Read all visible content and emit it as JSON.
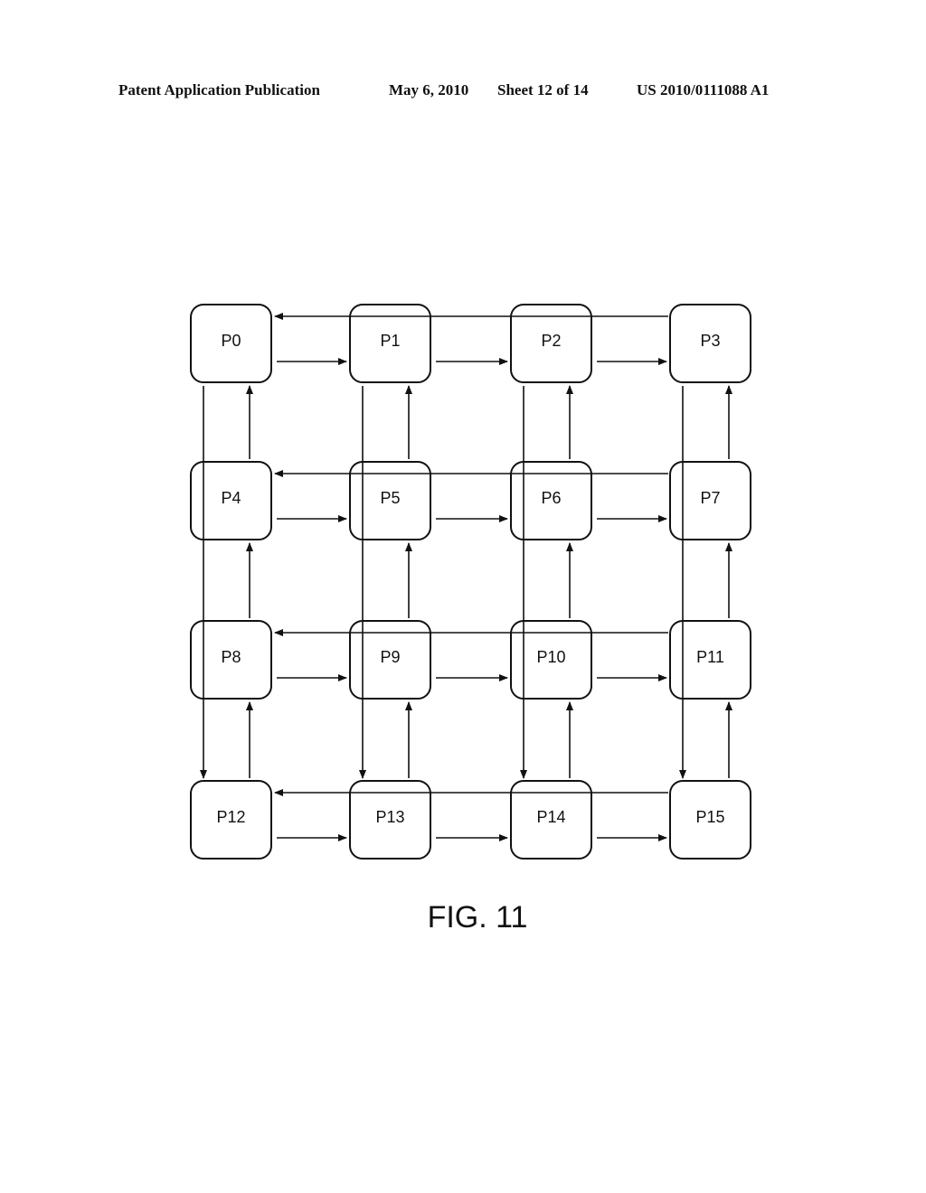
{
  "header": {
    "publication": "Patent Application Publication",
    "date": "May 6, 2010",
    "sheet": "Sheet 12 of 14",
    "number": "US 2010/0111088 A1"
  },
  "figure": {
    "caption": "FIG. 11",
    "grid": {
      "rows": 4,
      "cols": 4
    },
    "nodes": [
      "P0",
      "P1",
      "P2",
      "P3",
      "P4",
      "P5",
      "P6",
      "P7",
      "P8",
      "P9",
      "P10",
      "P11",
      "P12",
      "P13",
      "P14",
      "P15"
    ],
    "edges": {
      "row_forward": "each node -> right neighbour in same row",
      "row_wraparound": "rightmost node of each row -> leftmost node of same row",
      "column_upward": "each node -> node directly above in same column",
      "column_wraparound": "top node of each column -> bottom node of same column"
    }
  }
}
